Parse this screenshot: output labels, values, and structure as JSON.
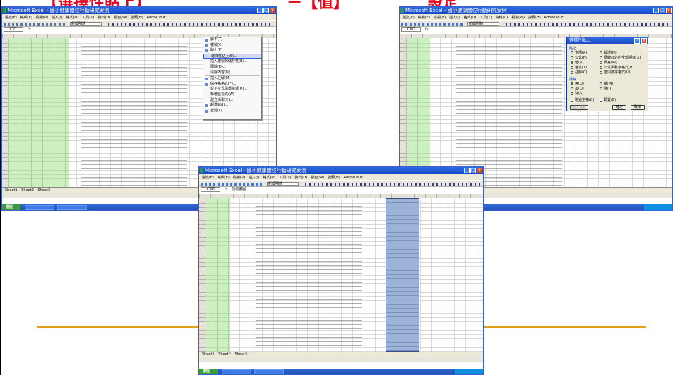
{
  "headings": {
    "left": "【選擇性貼上】",
    "middle": "－【值】",
    "right": "設定"
  },
  "excel": {
    "title": "Microsoft Excel - 國小健康體位行動研究案例",
    "menu": [
      "檔案(F)",
      "編輯(E)",
      "檢視(V)",
      "插入(I)",
      "格式(O)",
      "工具(T)",
      "資料(D)",
      "視窗(W)",
      "說明(H)",
      "Adobe PDF"
    ],
    "font_box": "新細明體",
    "sheet_tabs": [
      "Sheet1",
      "Sheet2",
      "Sheet3"
    ],
    "start_label": "開始"
  },
  "windows": {
    "left": {
      "name_box": "CV1",
      "formula": ""
    },
    "right": {
      "name_box": "CW1",
      "formula": ""
    },
    "center": {
      "name_box": "CW1",
      "formula": "前測腰圍"
    }
  },
  "context_menu": {
    "items": [
      "剪下(T)",
      "複製(C)",
      "貼上(P)",
      "選擇性貼上(S)...",
      "插入複製的儲存格(E)...",
      "刪除(D)...",
      "清除內容(N)",
      "插入註解(M)",
      "儲存格格式(F)...",
      "從下拉式清單挑選(K)...",
      "新增監看式(W)",
      "建立清單(C)...",
      "超連結(I)...",
      "查閱(L)..."
    ],
    "highlighted_index": 3
  },
  "paste_special": {
    "title": "選擇性貼上",
    "help_icon": "question-icon",
    "close_icon": "close-icon",
    "group_paste": "貼上",
    "paste_options": [
      "全部(A)",
      "公式(F)",
      "值(V)",
      "格式(T)",
      "註解(C)",
      "驗證(N)",
      "框線以外的全部項目(X)",
      "欄寬(W)",
      "公式與數字格式(R)",
      "值與數字格式(U)"
    ],
    "selected_paste": "值(V)",
    "group_operation": "運算",
    "operation_options": [
      "無(O)",
      "加(D)",
      "減(S)",
      "乘(M)",
      "除(I)"
    ],
    "selected_operation": "無(O)",
    "skip_blanks": "略過空格(B)",
    "transpose": "轉置(E)",
    "paste_link": "貼上連結(L)",
    "ok": "確定",
    "cancel": "取消"
  },
  "colors": {
    "heading_red": "#e8001c",
    "green_selection": "#ccf0c0",
    "blue_selection": "#9db2d8",
    "rule_orange": "#e0a020"
  }
}
